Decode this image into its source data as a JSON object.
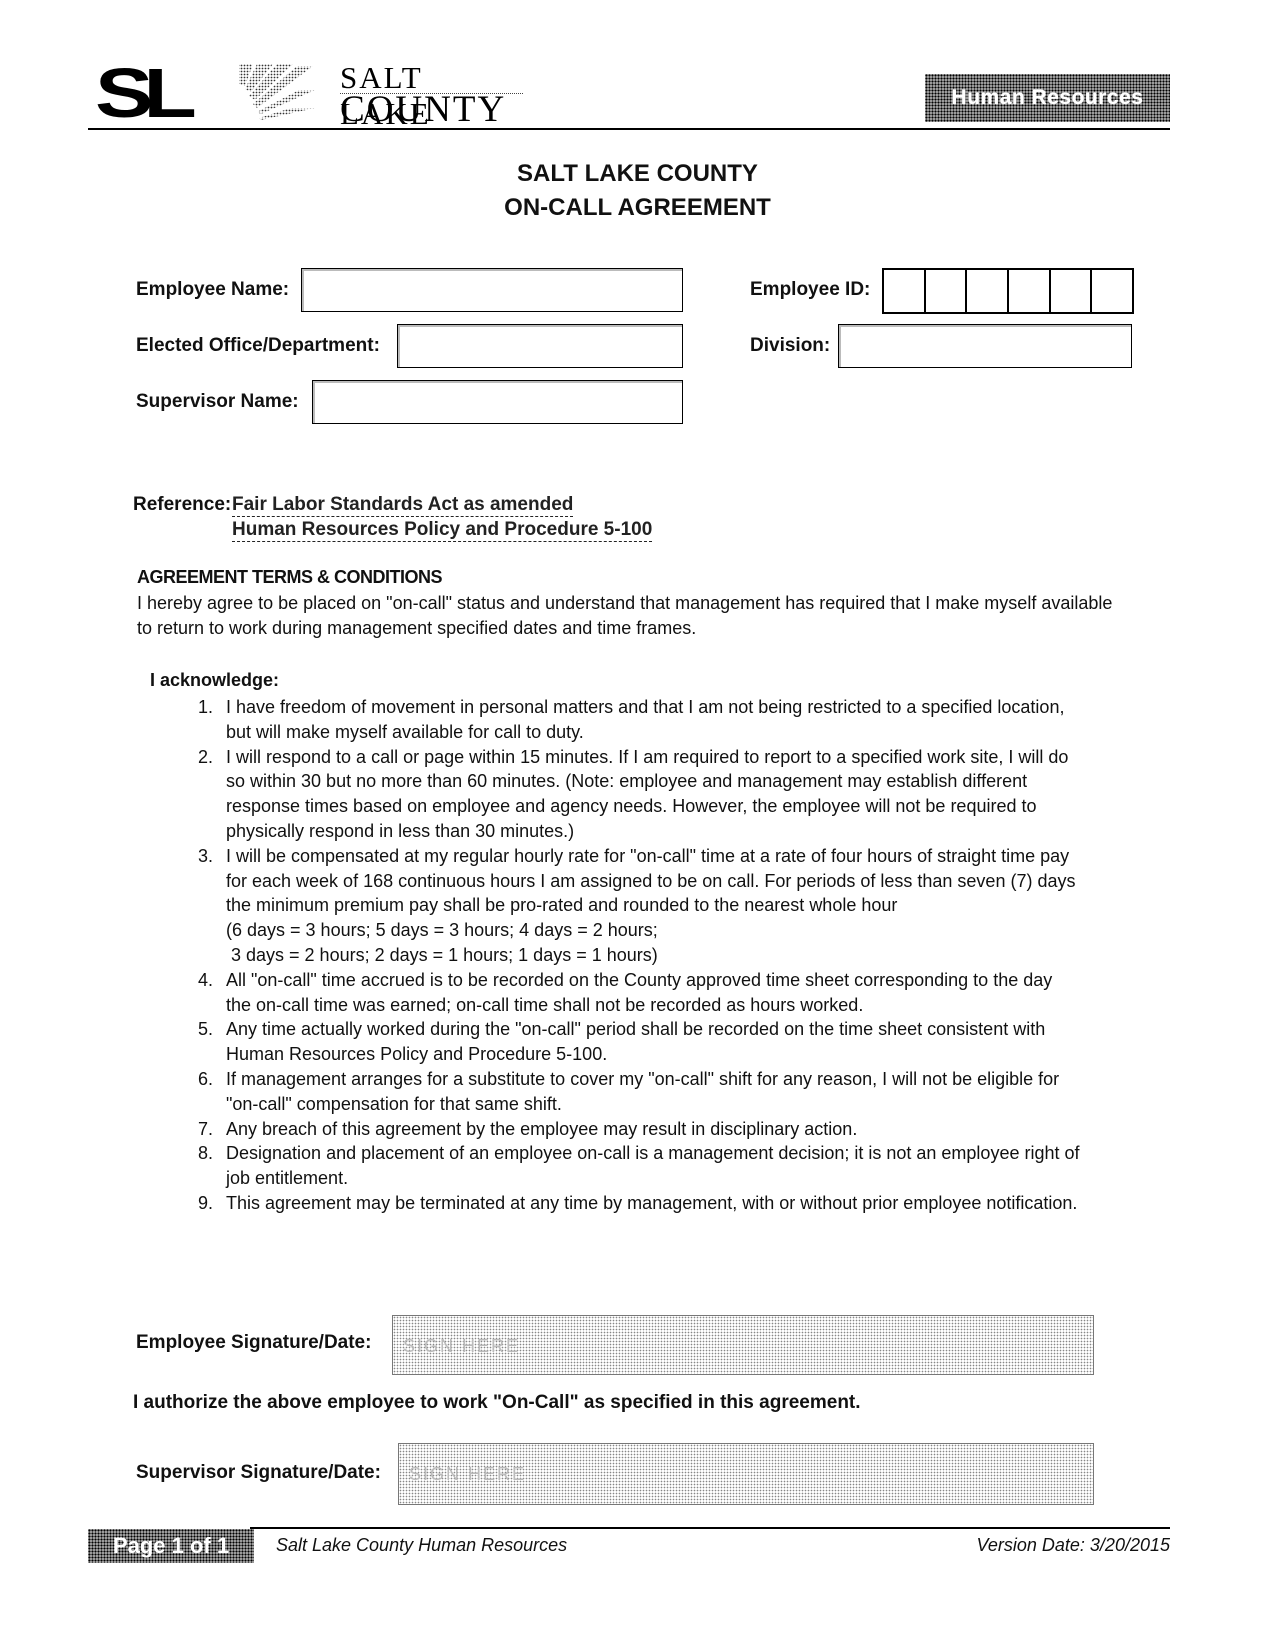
{
  "header": {
    "logo_mark": "SL",
    "logo_line1": "SALT LAKE",
    "logo_line2": "COUNTY",
    "department_badge": "Human Resources"
  },
  "title": {
    "line1": "SALT LAKE COUNTY",
    "line2": "ON-CALL AGREEMENT"
  },
  "form": {
    "employee_name_label": "Employee Name:",
    "employee_name_value": "",
    "elected_office_label": "Elected Office/Department:",
    "elected_office_value": "",
    "supervisor_name_label": "Supervisor Name:",
    "supervisor_name_value": "",
    "employee_id_label": "Employee ID:",
    "employee_id_cells": [
      "",
      "",
      "",
      "",
      "",
      ""
    ],
    "division_label": "Division:",
    "division_value": ""
  },
  "reference": {
    "label": "Reference:",
    "links": [
      "Fair Labor Standards Act as amended",
      "Human Resources Policy and Procedure 5-100"
    ]
  },
  "terms": {
    "heading": "AGREEMENT TERMS & CONDITIONS",
    "body": "I hereby agree to be placed on \"on-call\" status and understand that management has required that I make myself available to return to work during management specified dates and time frames.",
    "acknowledge_heading": "I acknowledge:",
    "items": [
      {
        "num": "1.",
        "text": "I have freedom of movement in personal matters and that I am not being restricted to a specified location, but will make myself available for call to duty."
      },
      {
        "num": "2.",
        "text": "I will respond to a call or page within 15 minutes. If I am required to report to a specified work site, I will do so within 30 but no more than 60 minutes. (Note: employee and management may establish different response times based on employee and agency needs. However, the employee will not be required to physically respond in less than 30 minutes.)"
      },
      {
        "num": "3.",
        "text": "I will be compensated at my regular hourly rate for \"on-call\" time at a rate of four hours of straight time pay for each week of 168 continuous hours I am assigned to be on call. For periods of less than seven (7) days the minimum premium pay shall be pro-rated and rounded to the nearest whole hour",
        "sub1": "(6 days = 3 hours; 5 days = 3 hours; 4 days = 2 hours;",
        "sub2": " 3 days = 2 hours; 2 days = 1 hours; 1 days = 1 hours)"
      },
      {
        "num": "4.",
        "text": "All \"on-call\" time accrued is to be recorded on the County approved time sheet corresponding to the day the on-call time was earned; on-call time shall not be recorded as hours worked."
      },
      {
        "num": "5.",
        "text": "Any time actually worked during the \"on-call\" period shall be recorded on the time sheet consistent with Human Resources Policy and Procedure 5-100."
      },
      {
        "num": "6.",
        "text": "If management arranges for a substitute to cover my \"on-call\" shift for any reason, I will not be eligible for \"on-call\" compensation for that same shift."
      },
      {
        "num": "7.",
        "text": "Any breach of this agreement by the employee may result in disciplinary action."
      },
      {
        "num": "8.",
        "text": "Designation and placement of an employee on-call is a management decision; it is not an employee right of job entitlement."
      },
      {
        "num": "9.",
        "text": "This agreement may be terminated at any time by management, with or without prior employee notification."
      }
    ]
  },
  "signatures": {
    "employee_label": "Employee Signature/Date:",
    "employee_placeholder": "SIGN HERE",
    "authorization_text": "I authorize the above employee to work \"On-Call\" as specified in this agreement.",
    "supervisor_label": "Supervisor Signature/Date:",
    "supervisor_placeholder": "SIGN HERE"
  },
  "footer": {
    "page_label": "Page 1 of 1",
    "center_text": "Salt Lake County Human Resources",
    "version_date": "Version Date: 3/20/2015"
  }
}
